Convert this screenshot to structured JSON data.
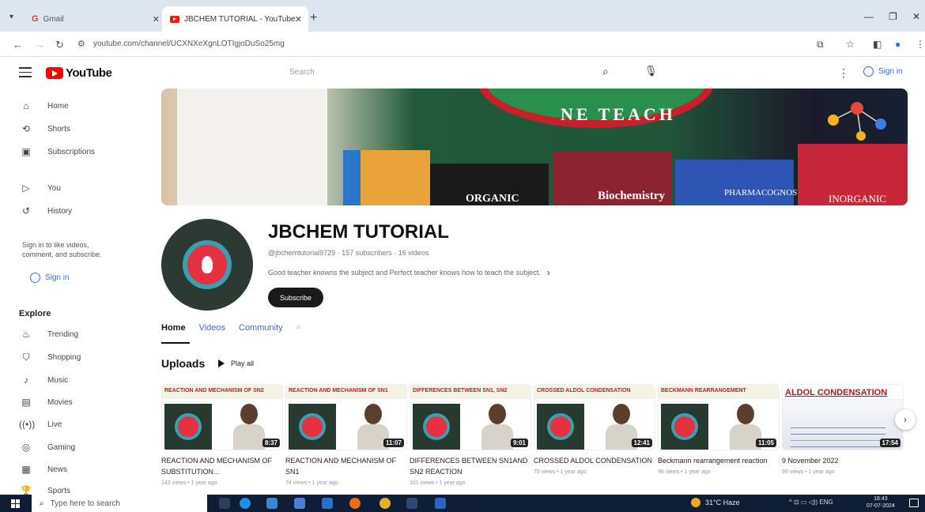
{
  "browser": {
    "tabs": [
      {
        "label": "Gmail"
      },
      {
        "label": "JBCHEM TUTORIAL - YouTube"
      }
    ],
    "url": "youtube.com/channel/UCXNXeXgnLOTIgjoDuSo25mg"
  },
  "masthead": {
    "logo_text": "YouTube",
    "search_placeholder": "Search",
    "sign_in": "Sign in"
  },
  "sidebar": {
    "items": [
      {
        "label": "Home",
        "icon": "home-icon"
      },
      {
        "label": "Shorts",
        "icon": "shorts-icon"
      },
      {
        "label": "Subscriptions",
        "icon": "subscriptions-icon"
      },
      {
        "label": "You",
        "icon": "you-icon"
      },
      {
        "label": "History",
        "icon": "history-icon"
      }
    ],
    "signin_note": "Sign in to like videos, comment, and subscribe.",
    "signin_button": "Sign in",
    "explore_heading": "Explore",
    "explore_items": [
      {
        "label": "Trending",
        "icon": "trending-icon"
      },
      {
        "label": "Shopping",
        "icon": "shopping-icon"
      },
      {
        "label": "Music",
        "icon": "music-icon"
      },
      {
        "label": "Movies",
        "icon": "movies-icon"
      },
      {
        "label": "Live",
        "icon": "live-icon"
      },
      {
        "label": "Gaming",
        "icon": "gaming-icon"
      },
      {
        "label": "News",
        "icon": "news-icon"
      },
      {
        "label": "Sports",
        "icon": "sports-icon"
      }
    ]
  },
  "banner": {
    "arc_text": "NE TEACH",
    "book_texts": [
      "ORGANIC",
      "Biochemistry",
      "PHARMACOGNOSY",
      "INORGANIC"
    ]
  },
  "channel": {
    "name": "JBCHEM TUTORIAL",
    "handle": "@jbchemtutorial9729",
    "subscribers": "157 subscribers",
    "videos": "16 videos",
    "description": "Good teacher knowns the subject and Perfect teacher knows how to teach the subject.",
    "subscribe_label": "Subscribe"
  },
  "tabs": [
    "Home",
    "Videos",
    "Community"
  ],
  "uploads": {
    "heading": "Uploads",
    "play_all": "Play all",
    "videos": [
      {
        "thumb_text": "REACTION AND MECHANISM OF SN2",
        "duration": "8:37",
        "title": "REACTION AND MECHANISM OF SUBSTITUTION...",
        "stats": "143 views • 1 year ago"
      },
      {
        "thumb_text": "REACTION AND MECHANISM OF SN1",
        "duration": "11:07",
        "title": "REACTION AND MECHANISM OF SN1",
        "stats": "74 views • 1 year ago"
      },
      {
        "thumb_text": "DIFFERENCES BETWEEN SN1, SN2",
        "duration": "9:01",
        "title": "DIFFERENCES BETWEEN SN1AND SN2 REACTION",
        "stats": "101 views • 1 year ago"
      },
      {
        "thumb_text": "CROSSED ALDOL CONDENSATION",
        "duration": "12:41",
        "title": "CROSSED ALDOL CONDENSATION",
        "stats": "75 views • 1 year ago"
      },
      {
        "thumb_text": "BECKMANN REARRANGEMENT",
        "duration": "11:05",
        "title": "Beckmann rearrangement reaction",
        "stats": "96 views • 1 year ago"
      },
      {
        "thumb_text": "ALDOL CONDENSATION",
        "duration": "17:54",
        "title": "9 November 2022",
        "stats": "99 views • 1 year ago"
      }
    ]
  },
  "taskbar": {
    "search_placeholder": "Type here to search",
    "weather": "31°C Haze",
    "tray": "ENG",
    "time": "18:43",
    "date": "07-07-2024"
  }
}
